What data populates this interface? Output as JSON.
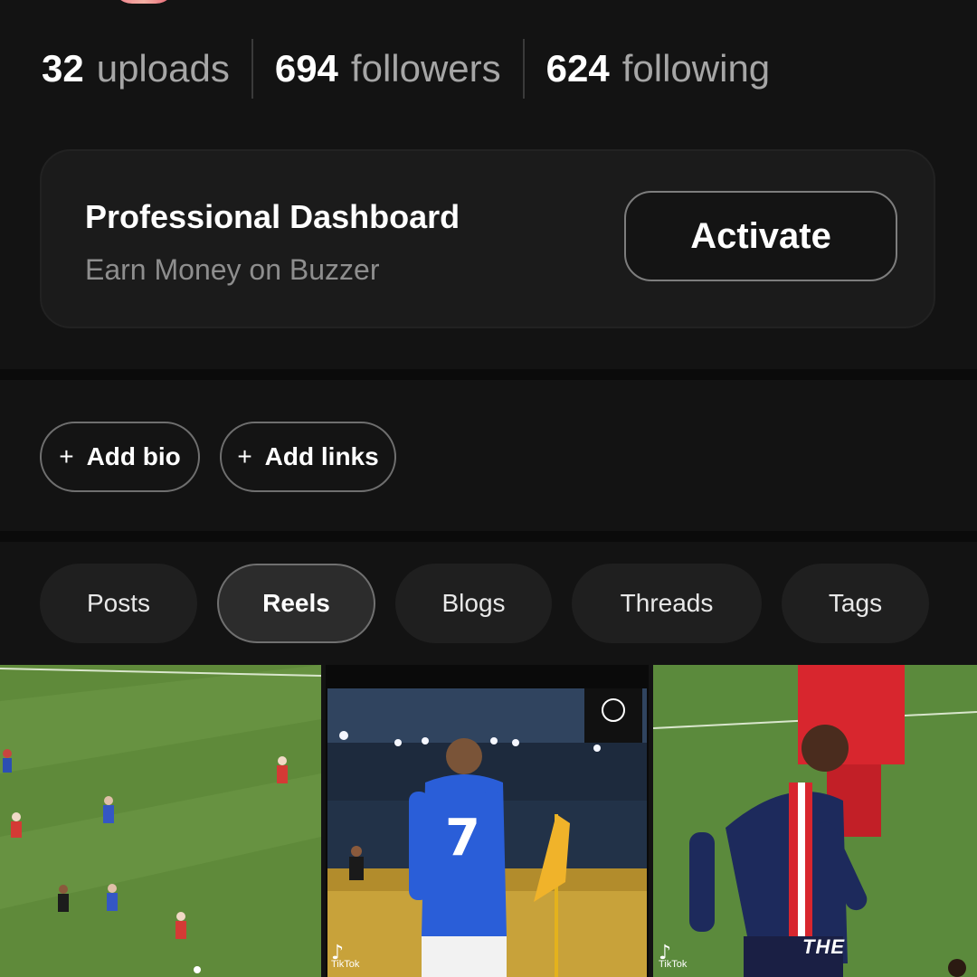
{
  "stats": {
    "uploads": {
      "count": "32",
      "label": "uploads"
    },
    "followers": {
      "count": "694",
      "label": "followers"
    },
    "following": {
      "count": "624",
      "label": "following"
    }
  },
  "pro_card": {
    "title": "Professional Dashboard",
    "subtitle": "Earn Money on Buzzer",
    "button_label": "Activate"
  },
  "chips": [
    {
      "icon": "+",
      "label": "Add bio"
    },
    {
      "icon": "+",
      "label": "Add links"
    }
  ],
  "tabs": [
    {
      "label": "Posts",
      "active": false
    },
    {
      "label": "Reels",
      "active": true
    },
    {
      "label": "Blogs",
      "active": false
    },
    {
      "label": "Threads",
      "active": false
    },
    {
      "label": "Tags",
      "active": false
    }
  ],
  "reels": [
    {
      "watermark": "",
      "caption": ""
    },
    {
      "watermark": "TikTok",
      "caption": "",
      "jersey_number": "7"
    },
    {
      "watermark": "TikTok",
      "caption": "THE"
    }
  ],
  "colors": {
    "background": "#131313",
    "card": "#1b1b1b",
    "muted_text": "#a6a6a6",
    "pitch_green": "#5f8a3a"
  },
  "icons": [
    "plus-icon",
    "tiktok-icon"
  ]
}
